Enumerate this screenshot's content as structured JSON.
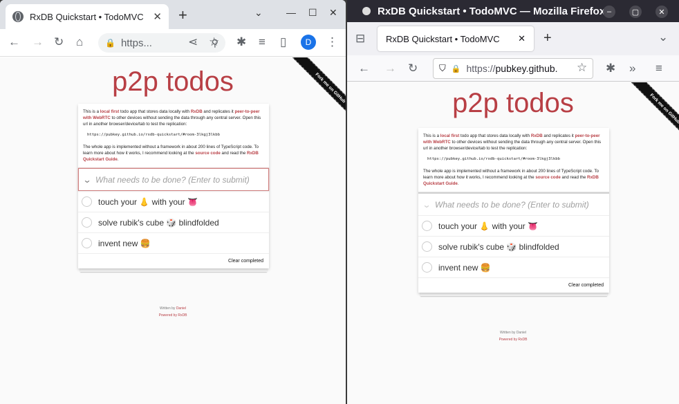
{
  "chrome": {
    "tab_title": "RxDB Quickstart • TodoMVC",
    "tab_close": "✕",
    "new_tab": "+",
    "url_text": "https...",
    "profile_initial": "D"
  },
  "firefox": {
    "window_title": "RxDB Quickstart • TodoMVC — Mozilla Firefox",
    "tab_title": "RxDB Quickstart • TodoMVC",
    "tab_close": "✕",
    "new_tab": "+",
    "url_prefix": "https://",
    "url_host": "pubkey.github."
  },
  "app": {
    "title": "p2p todos",
    "intro_part1": "This is a ",
    "intro_link1": "local first",
    "intro_part2": " todo app that stores data locally with ",
    "intro_link2": "RxDB",
    "intro_part3": " and replicates it ",
    "intro_link3": "peer-to-peer with WebRTC",
    "intro_part4": " to other devices without sending the data through any central server. Open this url in another browser/device/tab to test the replication:",
    "room_url": "https://pubkey.github.io/rxdb-quickstart/#room-3lkgj3lkbb",
    "intro2_part1": "The whole app is implemented without a framework in about 200 lines of TypeScript code. To learn more about how it works, I recommend looking at the ",
    "intro2_link1": "source code",
    "intro2_part2": " and read the ",
    "intro2_link2": "RxDB Quickstart Guide",
    "intro2_part3": ".",
    "input_placeholder": "What needs to be done? (Enter to submit)",
    "todos": [
      {
        "text": "touch your 👃 with your 👅"
      },
      {
        "text": "solve rubik's cube 🎲 blindfolded"
      },
      {
        "text": "invent new 🍔"
      }
    ],
    "firefox_todos": [
      {
        "text": "touch your 👃 with your 👅"
      },
      {
        "text": "solve rubik's cube 🎲 blindfolded"
      },
      {
        "text": "invent new 🍔"
      }
    ],
    "clear_completed": "Clear completed",
    "written_by": "Written by ",
    "author": "Daniel",
    "powered_by": "Powered by RxDB",
    "ribbon": "Fork me on GitHub"
  }
}
